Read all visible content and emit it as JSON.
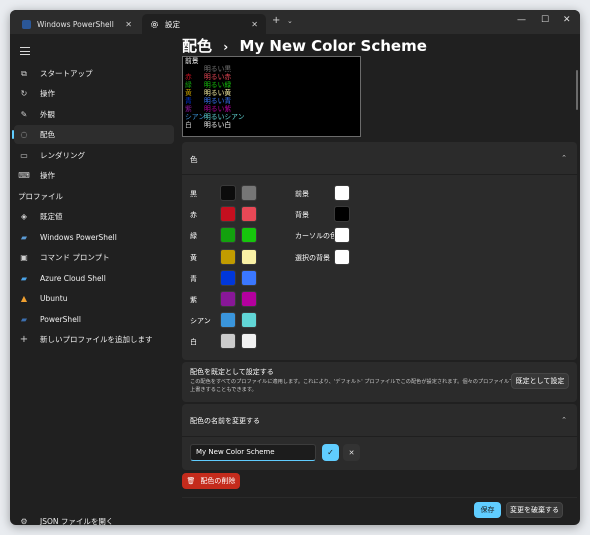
{
  "titlebar": {
    "tabs": [
      {
        "label": "Windows PowerShell",
        "active": false
      },
      {
        "label": "設定",
        "active": true
      }
    ],
    "new_tab": "+",
    "dropdown": "⌄",
    "minimize": "—",
    "maximize": "☐",
    "close": "✕",
    "tab_close": "✕"
  },
  "sidebar": {
    "items": [
      {
        "label": "スタートアップ",
        "icon": "startup-icon"
      },
      {
        "label": "操作",
        "icon": "interaction-icon"
      },
      {
        "label": "外観",
        "icon": "appearance-icon"
      },
      {
        "label": "配色",
        "icon": "color-schemes-icon"
      },
      {
        "label": "レンダリング",
        "icon": "rendering-icon"
      },
      {
        "label": "操作",
        "icon": "actions-icon"
      }
    ],
    "profiles_header": "プロファイル",
    "profiles": [
      {
        "label": "既定値",
        "icon": "defaults-icon"
      },
      {
        "label": "Windows PowerShell",
        "icon": "powershell-icon"
      },
      {
        "label": "コマンド プロンプト",
        "icon": "cmd-icon"
      },
      {
        "label": "Azure Cloud Shell",
        "icon": "azure-icon"
      },
      {
        "label": "Ubuntu",
        "icon": "ubuntu-icon"
      },
      {
        "label": "PowerShell",
        "icon": "powershell-core-icon"
      },
      {
        "label": "新しいプロファイルを追加します",
        "icon": "plus-icon"
      }
    ],
    "open_json": "JSON ファイルを開く"
  },
  "main": {
    "breadcrumb_root": "配色",
    "breadcrumb_sep": "›",
    "breadcrumb_current": "My New Color Scheme",
    "preview": {
      "rows": [
        {
          "a": "前景",
          "b": "",
          "ca": "#ffffff",
          "cb": "#ffffff"
        },
        {
          "a": "",
          "b": "明るい黒",
          "ca": "#767676",
          "cb": "#767676"
        },
        {
          "a": "赤",
          "b": "明るい赤",
          "ca": "#c50f1f",
          "cb": "#e74856"
        },
        {
          "a": "緑",
          "b": "明るい緑",
          "ca": "#13a10e",
          "cb": "#16c60c"
        },
        {
          "a": "黄",
          "b": "明るい黄",
          "ca": "#c19c00",
          "cb": "#f9f1a5"
        },
        {
          "a": "青",
          "b": "明るい青",
          "ca": "#0037da",
          "cb": "#3b78ff"
        },
        {
          "a": "紫",
          "b": "明るい紫",
          "ca": "#881798",
          "cb": "#b4009e"
        },
        {
          "a": "シアン",
          "b": "明るいシアン",
          "ca": "#3a96dd",
          "cb": "#61d6d6"
        },
        {
          "a": "白",
          "b": "明るい白",
          "ca": "#cccccc",
          "cb": "#f2f2f2"
        }
      ]
    },
    "colors_section": {
      "title": "色",
      "colors": [
        {
          "label": "黒",
          "normal": "#0c0c0c",
          "bright": "#767676"
        },
        {
          "label": "赤",
          "normal": "#c50f1f",
          "bright": "#e74856"
        },
        {
          "label": "緑",
          "normal": "#13a10e",
          "bright": "#16c60c"
        },
        {
          "label": "黄",
          "normal": "#c19c00",
          "bright": "#f9f1a5"
        },
        {
          "label": "青",
          "normal": "#0037da",
          "bright": "#3b78ff"
        },
        {
          "label": "紫",
          "normal": "#881798",
          "bright": "#b4009e"
        },
        {
          "label": "シアン",
          "normal": "#3a96dd",
          "bright": "#61d6d6"
        },
        {
          "label": "白",
          "normal": "#cccccc",
          "bright": "#f2f2f2"
        }
      ],
      "system": [
        {
          "label": "前景",
          "color": "#ffffff"
        },
        {
          "label": "背景",
          "color": "#000000"
        },
        {
          "label": "カーソルの色",
          "color": "#ffffff"
        },
        {
          "label": "選択の背景",
          "color": "#ffffff"
        }
      ]
    },
    "set_default": {
      "title": "配色を既定として設定する",
      "description_line1": "この配色をすべてのプロファイルに適用します。これにより、'デフォルト' プロファイルでこの配色が設定されます。個々のプロファイルで",
      "description_line2": "上書きすることもできます。",
      "button": "既定として設定"
    },
    "rename": {
      "title": "配色の名前を変更する",
      "input_value": "My New Color Scheme",
      "confirm": "✓",
      "cancel": "✕"
    },
    "delete_button": "配色の削除",
    "save_button": "保存",
    "discard_button": "変更を破棄する"
  },
  "colors": {
    "accent": "#60cdff",
    "danger": "#c42b1c"
  }
}
